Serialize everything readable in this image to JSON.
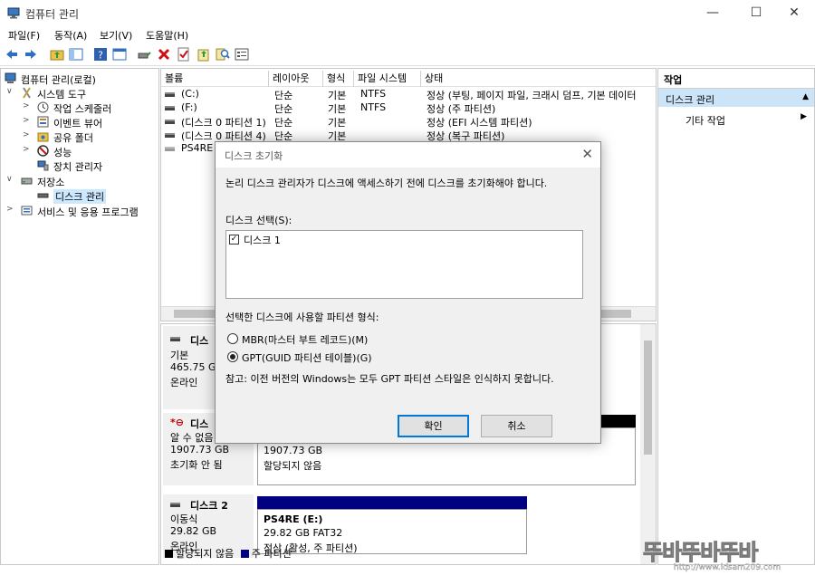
{
  "window": {
    "title": "컴퓨터 관리",
    "minimize": "—",
    "maximize": "☐",
    "close": "✕"
  },
  "menu": [
    "파일(F)",
    "동작(A)",
    "보기(V)",
    "도움말(H)"
  ],
  "tree": {
    "items": [
      {
        "label": "컴퓨터 관리(로컬)",
        "expander": "",
        "icon": "computer-management-icon"
      },
      {
        "label": "시스템 도구",
        "expander": "∨",
        "icon": "system-tools-icon"
      },
      {
        "label": "작업 스케줄러",
        "expander": ">",
        "icon": "task-scheduler-icon"
      },
      {
        "label": "이벤트 뷰어",
        "expander": ">",
        "icon": "event-viewer-icon"
      },
      {
        "label": "공유 폴더",
        "expander": ">",
        "icon": "shared-folders-icon"
      },
      {
        "label": "성능",
        "expander": ">",
        "icon": "performance-icon"
      },
      {
        "label": "장치 관리자",
        "expander": "",
        "icon": "device-manager-icon"
      },
      {
        "label": "저장소",
        "expander": "∨",
        "icon": "storage-icon"
      },
      {
        "label": "디스크 관리",
        "expander": "",
        "icon": "disk-management-icon"
      },
      {
        "label": "서비스 및 응용 프로그램",
        "expander": ">",
        "icon": "services-apps-icon"
      }
    ]
  },
  "volumes": {
    "columns": [
      "볼륨",
      "레이아웃",
      "형식",
      "파일 시스템",
      "상태"
    ],
    "rows": [
      [
        "(C:)",
        "단순",
        "기본",
        "NTFS",
        "정상 (부팅, 페이지 파일, 크래시 덤프, 기본 데이터"
      ],
      [
        "(F:)",
        "단순",
        "기본",
        "NTFS",
        "정상 (주 파티션)"
      ],
      [
        "(디스크 0 파티션 1)",
        "단순",
        "기본",
        "",
        "정상 (EFI 시스템 파티션)"
      ],
      [
        "(디스크 0 파티션 4)",
        "단순",
        "기본",
        "",
        "정상 (복구 파티션)"
      ],
      [
        "PS4RE (E:)",
        "",
        "",
        "",
        ""
      ]
    ]
  },
  "disks": {
    "disk0": {
      "name": "디스",
      "type": "기본",
      "size": "465.75 GB",
      "status": "온라인"
    },
    "disk1": {
      "name": "디스",
      "type": "알 수 없음",
      "size": "1907.73 GB",
      "status": "초기화 안 됨",
      "area_size": "1907.73 GB",
      "area_status": "할당되지 않음"
    },
    "disk2": {
      "name": "디스크 2",
      "type": "이동식",
      "size": "29.82 GB",
      "status": "온라인",
      "vol_name": "PS4RE  (E:)",
      "vol_size": "29.82 GB FAT32",
      "vol_status": "정상 (활성, 주 파티션)"
    }
  },
  "legend": {
    "unallocated": "할당되지 않음",
    "primary": "주 파티션",
    "unallocated_color": "#000000",
    "primary_color": "#000080"
  },
  "actions": {
    "header": "작업",
    "section": "디스크 관리",
    "section_arrow": "▲",
    "more": "기타 작업",
    "more_arrow": "▶"
  },
  "dialog": {
    "title": "디스크 초기화",
    "message": "논리 디스크 관리자가 디스크에 액세스하기 전에 디스크를 초기화해야 합니다.",
    "select_label": "디스크 선택(S):",
    "disk_item": "디스크 1",
    "disk_checked": true,
    "partition_label": "선택한 디스크에 사용할 파티션 형식:",
    "option_mbr": "MBR(마스터 부트 레코드)(M)",
    "option_gpt": "GPT(GUID 파티션 테이블)(G)",
    "selected": "gpt",
    "note": "참고: 이전 버전의 Windows는 모두 GPT 파티션 스타일은 인식하지 못합니다.",
    "ok": "확인",
    "cancel": "취소"
  },
  "watermark": {
    "text": "뚜바뚜바뚜바",
    "url": "http://www.idsam209.com"
  },
  "colors": {
    "selection": "#cce8ff",
    "accent": "#0078d7",
    "disk_bar": "#000080"
  }
}
